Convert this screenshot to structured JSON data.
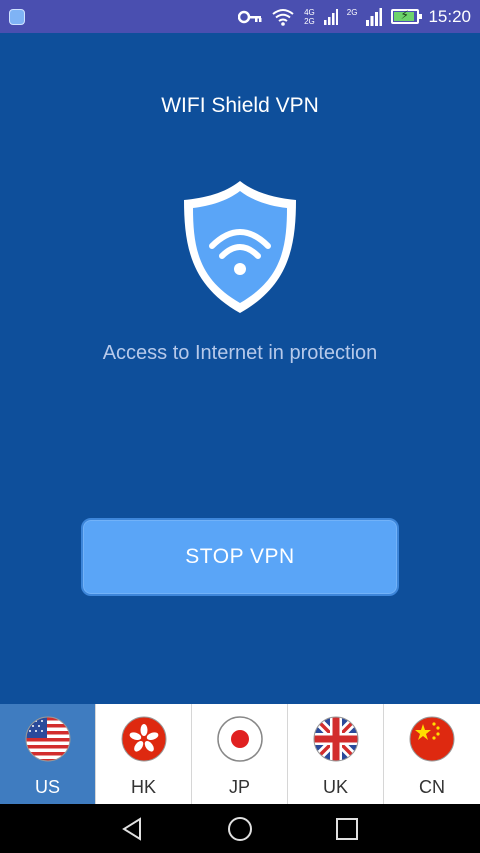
{
  "status_bar": {
    "time": "15:20",
    "network_top": "4G",
    "network_bottom": "2G",
    "network_2g": "2G",
    "icons": [
      "app-icon",
      "key-icon",
      "wifi-icon",
      "signal-icon",
      "signal-icon",
      "battery-icon"
    ]
  },
  "app": {
    "title": "WIFI Shield VPN",
    "subtitle": "Access to Internet in protection",
    "stop_button_label": "STOP VPN"
  },
  "countries": [
    {
      "code": "US",
      "flag": "us-flag-icon",
      "selected": true
    },
    {
      "code": "HK",
      "flag": "hk-flag-icon",
      "selected": false
    },
    {
      "code": "JP",
      "flag": "jp-flag-icon",
      "selected": false
    },
    {
      "code": "UK",
      "flag": "uk-flag-icon",
      "selected": false
    },
    {
      "code": "CN",
      "flag": "cn-flag-icon",
      "selected": false
    }
  ],
  "nav": [
    "back-icon",
    "home-icon",
    "recents-icon"
  ],
  "colors": {
    "background": "#0e4f9b",
    "status_bar": "#4a4fb0",
    "button": "#5aa5f7",
    "selected_country": "#3f7cc0"
  }
}
